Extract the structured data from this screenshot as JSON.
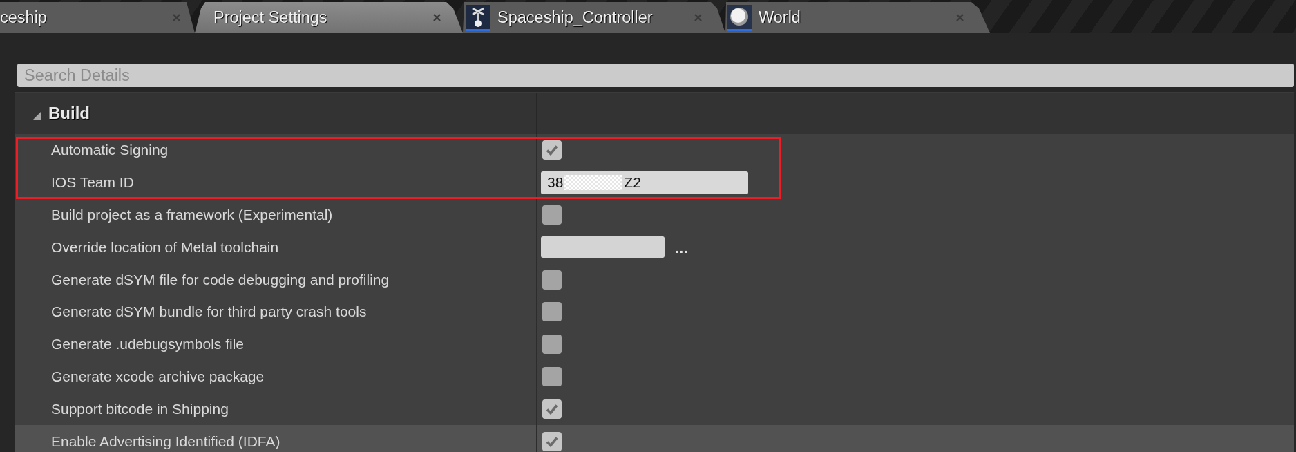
{
  "tabs": [
    {
      "label": "ceship",
      "kind": "plain",
      "selected": false
    },
    {
      "label": "Project Settings",
      "kind": "plain",
      "selected": true
    },
    {
      "label": "Spaceship_Controller",
      "kind": "blueprint",
      "selected": false
    },
    {
      "label": "World",
      "kind": "level",
      "selected": false
    }
  ],
  "search": {
    "placeholder": "Search Details"
  },
  "section": {
    "title": "Build",
    "expanded": true
  },
  "settings": [
    {
      "label": "Automatic Signing",
      "kind": "checkbox",
      "checked": true,
      "highlighted": true,
      "hovered": false
    },
    {
      "label": "IOS Team ID",
      "kind": "text",
      "value_start": "38",
      "value_end": "Z2",
      "redacted": true,
      "highlighted": true,
      "hovered": false
    },
    {
      "label": "Build project as a framework (Experimental)",
      "kind": "checkbox",
      "checked": false,
      "highlighted": false,
      "hovered": false
    },
    {
      "label": "Override location of Metal toolchain",
      "kind": "path",
      "browse_label": "...",
      "highlighted": false,
      "hovered": false
    },
    {
      "label": "Generate dSYM file for code debugging and profiling",
      "kind": "checkbox",
      "checked": false,
      "highlighted": false,
      "hovered": false
    },
    {
      "label": "Generate dSYM bundle for third party crash tools",
      "kind": "checkbox",
      "checked": false,
      "highlighted": false,
      "hovered": false
    },
    {
      "label": "Generate .udebugsymbols file",
      "kind": "checkbox",
      "checked": false,
      "highlighted": false,
      "hovered": false
    },
    {
      "label": "Generate xcode archive package",
      "kind": "checkbox",
      "checked": false,
      "highlighted": false,
      "hovered": false
    },
    {
      "label": "Support bitcode in Shipping",
      "kind": "checkbox",
      "checked": true,
      "highlighted": false,
      "hovered": false
    },
    {
      "label": "Enable Advertising Identified (IDFA)",
      "kind": "checkbox",
      "checked": true,
      "highlighted": false,
      "hovered": true
    }
  ]
}
